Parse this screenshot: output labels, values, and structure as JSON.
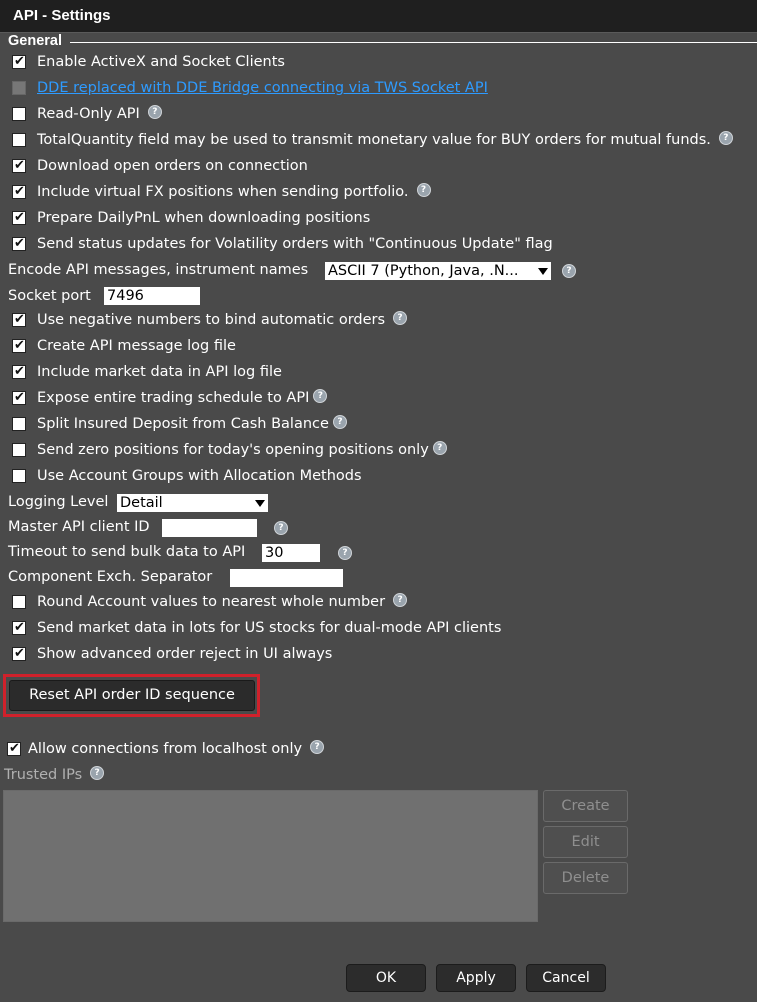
{
  "window": {
    "title": "API - Settings"
  },
  "section": {
    "general": "General"
  },
  "options": {
    "enable_activex": {
      "label": "Enable ActiveX and Socket Clients",
      "checked": true
    },
    "dde_link": {
      "label": "DDE replaced with DDE Bridge connecting via TWS Socket API"
    },
    "read_only": {
      "label": "Read-Only API",
      "checked": false
    },
    "total_quantity": {
      "label": "TotalQuantity field may be used to transmit monetary value for BUY orders for mutual funds.",
      "checked": false
    },
    "download_open_orders": {
      "label": "Download open orders on connection",
      "checked": true
    },
    "include_virtual_fx": {
      "label": "Include virtual FX positions when sending portfolio.",
      "checked": true
    },
    "prepare_dailypnl": {
      "label": "Prepare DailyPnL when downloading positions",
      "checked": true
    },
    "send_status_vol": {
      "label": "Send status updates for Volatility orders with \"Continuous Update\" flag",
      "checked": true
    },
    "encode_api": {
      "label": "Encode API messages, instrument names",
      "value": "ASCII 7 (Python, Java, .N..."
    },
    "socket_port": {
      "label": "Socket port",
      "value": "7496"
    },
    "negative_numbers": {
      "label": "Use negative numbers to bind automatic orders",
      "checked": true
    },
    "create_log": {
      "label": "Create API message log file",
      "checked": true
    },
    "include_market_data": {
      "label": "Include market data in API log file",
      "checked": true
    },
    "expose_schedule": {
      "label": "Expose entire trading schedule to API",
      "checked": true
    },
    "split_insured": {
      "label": "Split Insured Deposit from Cash Balance",
      "checked": false
    },
    "send_zero_positions": {
      "label": "Send zero positions for today's opening positions only",
      "checked": false
    },
    "account_groups": {
      "label": "Use Account Groups with Allocation Methods",
      "checked": false
    },
    "logging_level": {
      "label": "Logging Level",
      "value": "Detail"
    },
    "master_client_id": {
      "label": "Master API client ID",
      "value": ""
    },
    "timeout_bulk": {
      "label": "Timeout to send bulk data to API",
      "value": "30"
    },
    "component_separator": {
      "label": "Component Exch. Separator",
      "value": ""
    },
    "round_account": {
      "label": "Round Account values to nearest whole number",
      "checked": false
    },
    "send_market_lots": {
      "label": "Send market data in lots for US stocks for dual-mode API clients",
      "checked": true
    },
    "show_reject": {
      "label": "Show advanced order reject in UI always",
      "checked": true
    }
  },
  "reset_button": "Reset API order ID sequence",
  "allow_localhost": {
    "label": "Allow connections from localhost only",
    "checked": true
  },
  "trusted_ips": {
    "label": "Trusted IPs",
    "create": "Create",
    "edit": "Edit",
    "delete": "Delete"
  },
  "footer": {
    "ok": "OK",
    "apply": "Apply",
    "cancel": "Cancel"
  },
  "colors": {
    "background": "#4a4a4a",
    "titlebar": "#1f1f1f",
    "highlight": "#d0212b",
    "link": "#2e9bff"
  }
}
